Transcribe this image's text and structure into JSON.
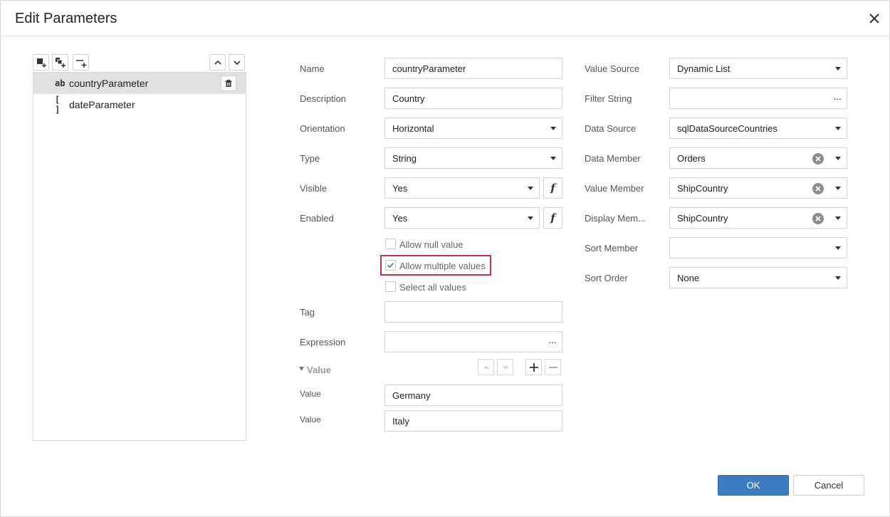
{
  "dialog": {
    "title": "Edit Parameters",
    "ok_label": "OK",
    "cancel_label": "Cancel"
  },
  "parameters": [
    {
      "type_glyph": "ab",
      "name": "countryParameter",
      "selected": true
    },
    {
      "type_glyph": "[ ]",
      "name": "dateParameter",
      "selected": false
    }
  ],
  "form": {
    "name": {
      "label": "Name",
      "value": "countryParameter"
    },
    "description": {
      "label": "Description",
      "value": "Country"
    },
    "orientation": {
      "label": "Orientation",
      "value": "Horizontal"
    },
    "type": {
      "label": "Type",
      "value": "String"
    },
    "visible": {
      "label": "Visible",
      "value": "Yes"
    },
    "enabled": {
      "label": "Enabled",
      "value": "Yes"
    },
    "function_glyph": "f",
    "allow_null": {
      "label": "Allow null value",
      "checked": false
    },
    "allow_multiple": {
      "label": "Allow multiple values",
      "checked": true
    },
    "select_all": {
      "label": "Select all values",
      "checked": false
    },
    "tag": {
      "label": "Tag",
      "value": ""
    },
    "expression": {
      "label": "Expression",
      "value": ""
    },
    "value_section": {
      "title": "Value",
      "values": [
        {
          "label": "Value",
          "value": "Germany"
        },
        {
          "label": "Value",
          "value": "Italy"
        }
      ]
    }
  },
  "source": {
    "value_source": {
      "label": "Value Source",
      "value": "Dynamic List"
    },
    "filter_string": {
      "label": "Filter String",
      "value": ""
    },
    "data_source": {
      "label": "Data Source",
      "value": "sqlDataSourceCountries"
    },
    "data_member": {
      "label": "Data Member",
      "value": "Orders"
    },
    "value_member": {
      "label": "Value Member",
      "value": "ShipCountry"
    },
    "display_member": {
      "label": "Display Mem...",
      "value": "ShipCountry"
    },
    "sort_member": {
      "label": "Sort Member",
      "value": ""
    },
    "sort_order": {
      "label": "Sort Order",
      "value": "None"
    }
  },
  "colors": {
    "accent": "#3d7cc0",
    "highlight_border": "#c1324f",
    "selected_row": "#e1e1e1"
  }
}
